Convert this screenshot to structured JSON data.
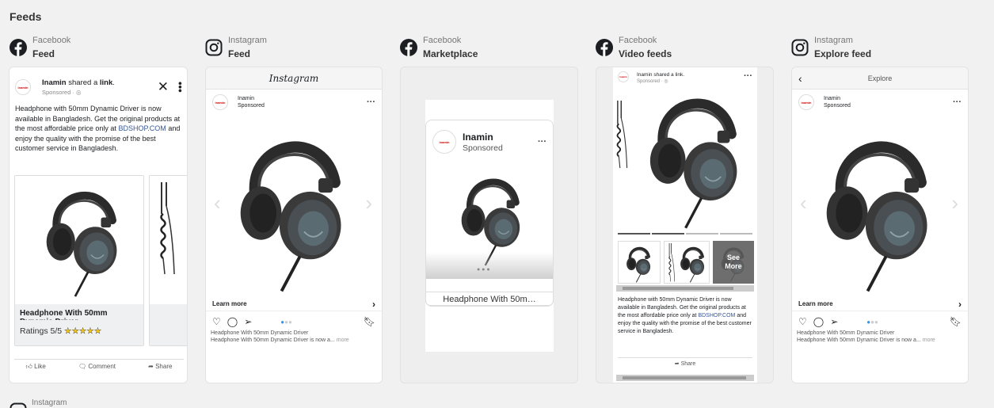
{
  "section_title": "Feeds",
  "brand": {
    "name": "Inamin",
    "logo_text": "inamin",
    "sponsored": "Sponsored"
  },
  "ad": {
    "headline": "Headphone With 50mm Dynamic Driver",
    "headline_short": "Headphone With 50m…",
    "ratings": "Ratings 5/5",
    "stars": "★★★★★",
    "body_before_link": "Headphone with 50mm Dynamic Driver is now available in Bangladesh. Get the original products at the most affordable price only at",
    "link_text": "BDSHOP.COM",
    "body_after_link": "and enjoy the quality with the promise of the best customer service in Bangladesh.",
    "ig_caption_title": "Headphone With 50mm Dynamic Driver",
    "ig_caption_body": "Headphone With 50mm Dynamic Driver is now a...",
    "ig_more": "more",
    "learn_more": "Learn more",
    "see_more": "See More"
  },
  "fb_post": {
    "shared_a": "shared a",
    "link_word": "link",
    "sponsored": "Sponsored · ",
    "actions": {
      "like": "Like",
      "comment": "Comment",
      "share": "Share"
    }
  },
  "columns": [
    {
      "platform": "Facebook",
      "placement": "Feed",
      "icon": "facebook-icon"
    },
    {
      "platform": "Instagram",
      "placement": "Feed",
      "icon": "instagram-icon"
    },
    {
      "platform": "Facebook",
      "placement": "Marketplace",
      "icon": "facebook-icon"
    },
    {
      "platform": "Facebook",
      "placement": "Video feeds",
      "icon": "facebook-icon"
    },
    {
      "platform": "Instagram",
      "placement": "Explore feed",
      "icon": "instagram-icon"
    }
  ],
  "instagram_wordmark": "Instagram",
  "explore_title": "Explore",
  "video_share": "Share",
  "next_section_platform": "Instagram",
  "colors": {
    "facebook": "#1877f2",
    "link": "#385898",
    "page_bg": "#f1f1f1",
    "carousel_dot_active": "#3897f0"
  }
}
